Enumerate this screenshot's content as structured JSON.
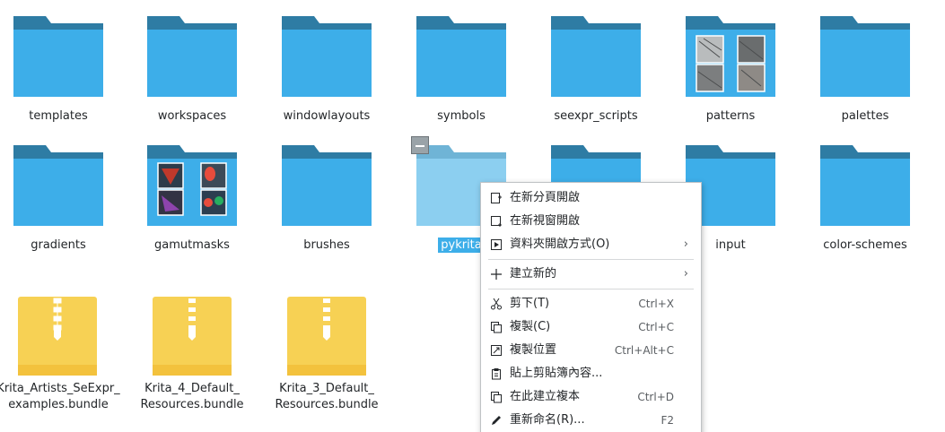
{
  "folders_row1": [
    {
      "name": "templates"
    },
    {
      "name": "workspaces"
    },
    {
      "name": "windowlayouts"
    },
    {
      "name": "symbols"
    },
    {
      "name": "seexpr_scripts"
    },
    {
      "name": "patterns"
    },
    {
      "name": "palettes"
    }
  ],
  "folders_row2": [
    {
      "name": "gradients"
    },
    {
      "name": "gamutmasks"
    },
    {
      "name": "brushes"
    },
    {
      "name": "pykrita"
    },
    {
      "name": "input"
    },
    {
      "name": "color-schemes"
    }
  ],
  "bundles": [
    {
      "line1": "Krita_Artists_SeExpr_",
      "line2": "examples.bundle"
    },
    {
      "line1": "Krita_4_Default_",
      "line2": "Resources.bundle"
    },
    {
      "line1": "Krita_3_Default_",
      "line2": "Resources.bundle"
    }
  ],
  "selected_folder_label": "pykrita",
  "context_menu": {
    "items": [
      {
        "label": "在新分頁開啟",
        "shortcut": "",
        "icon": "new-tab-icon"
      },
      {
        "label": "在新視窗開啟",
        "shortcut": "",
        "icon": "new-window-icon"
      },
      {
        "label": "資料夾開啟方式(O)",
        "shortcut": "",
        "icon": "open-with-icon"
      },
      {
        "label": "建立新的",
        "shortcut": "",
        "icon": "plus-icon"
      },
      {
        "label": "剪下(T)",
        "shortcut": "Ctrl+X",
        "icon": "scissors-icon"
      },
      {
        "label": "複製(C)",
        "shortcut": "Ctrl+C",
        "icon": "copy-icon"
      },
      {
        "label": "複製位置",
        "shortcut": "Ctrl+Alt+C",
        "icon": "copy-location-icon"
      },
      {
        "label": "貼上剪貼簿內容...",
        "shortcut": "",
        "icon": "paste-icon"
      },
      {
        "label": "在此建立複本",
        "shortcut": "Ctrl+D",
        "icon": "duplicate-icon"
      },
      {
        "label": "重新命名(R)...",
        "shortcut": "F2",
        "icon": "rename-icon"
      }
    ],
    "submenu_arrow": "›"
  },
  "colors": {
    "folder_front": "#3daee9",
    "folder_back": "#2e7ca4",
    "folder_selected_front": "#8ccff0",
    "folder_selected_back": "#6fb4d6",
    "zip_yellow": "#f7d154",
    "selection": "#3daee9"
  }
}
